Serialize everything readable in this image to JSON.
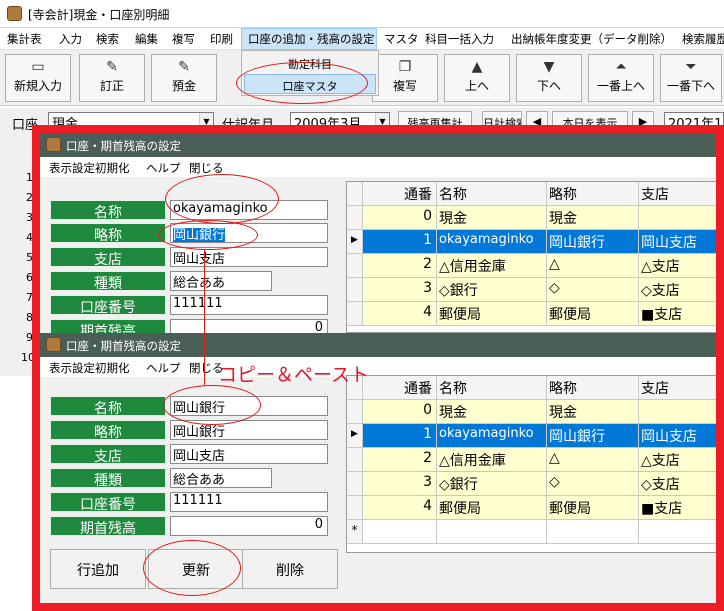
{
  "main": {
    "title": "[寺会計]現金・口座別明細",
    "menu": [
      "集計表",
      "入力",
      "検索",
      "編集",
      "複写",
      "印刷",
      "口座の追加・残高の設定",
      "マスタ",
      "科目一括入力",
      "出納帳年度変更（データ削除）",
      "検索履歴"
    ],
    "dropdown": [
      "勘定科目",
      "口座マスタ"
    ],
    "toolbar": [
      "新規入力",
      "訂正",
      "預金",
      "複写",
      "上へ",
      "下へ",
      "一番上へ",
      "一番下へ"
    ],
    "toolbar_icons": [
      "new-doc-icon",
      "pencil-icon",
      "pencil-icon",
      "copy-icon",
      "arrow-up-icon",
      "arrow-down-icon",
      "arrow-top-icon",
      "arrow-bottom-icon"
    ],
    "filter": {
      "account_label": "口座",
      "account_value": "現金",
      "period_label": "仕訳年月",
      "period_value": "2009年3月",
      "recalc_button": "残高再集計",
      "date_search_button": "日計検索",
      "today_button": "本日を表示",
      "date_value": "2021年1"
    },
    "row_numbers": [
      "1",
      "2",
      "3",
      "4",
      "5",
      "6",
      "7",
      "8",
      "9",
      "10"
    ]
  },
  "dialog1": {
    "title": "口座・期首残高の設定",
    "menu": [
      "表示設定初期化",
      "ヘルプ",
      "閉じる"
    ],
    "fields": [
      {
        "label": "名称",
        "value": "okayamaginko"
      },
      {
        "label": "略称",
        "value": "岡山銀行"
      },
      {
        "label": "支店",
        "value": "岡山支店"
      },
      {
        "label": "種類",
        "value": "総合ああ"
      },
      {
        "label": "口座番号",
        "value": "111111"
      },
      {
        "label": "期首残高",
        "value": "0"
      }
    ]
  },
  "dialog2": {
    "title": "口座・期首残高の設定",
    "menu": [
      "表示設定初期化",
      "ヘルプ",
      "閉じる"
    ],
    "fields": [
      {
        "label": "名称",
        "value": "岡山銀行"
      },
      {
        "label": "略称",
        "value": "岡山銀行"
      },
      {
        "label": "支店",
        "value": "岡山支店"
      },
      {
        "label": "種類",
        "value": "総合ああ"
      },
      {
        "label": "口座番号",
        "value": "111111"
      },
      {
        "label": "期首残高",
        "value": "0"
      }
    ],
    "buttons": [
      "行追加",
      "更新",
      "削除"
    ]
  },
  "grid": {
    "headers": [
      "通番",
      "名称",
      "略称",
      "支店"
    ],
    "rows": [
      [
        "0",
        "現金",
        "現金",
        ""
      ],
      [
        "1",
        "okayamaginko",
        "岡山銀行",
        "岡山支店"
      ],
      [
        "2",
        "△信用金庫",
        "△",
        "△支店"
      ],
      [
        "3",
        "◇銀行",
        "◇",
        "◇支店"
      ],
      [
        "4",
        "郵便局",
        "郵便局",
        "■支店"
      ]
    ],
    "selected_row": 1,
    "new_row_marker": "*",
    "current_row_marker": "▶"
  },
  "annotation": "コピー＆ペースト",
  "colors": {
    "label_green": "#1f8a3d",
    "selection_blue": "#0078d7",
    "frame_red": "#ee1c24",
    "row_yellow": "#ffffd0",
    "title_bar": "#4a5e58"
  }
}
